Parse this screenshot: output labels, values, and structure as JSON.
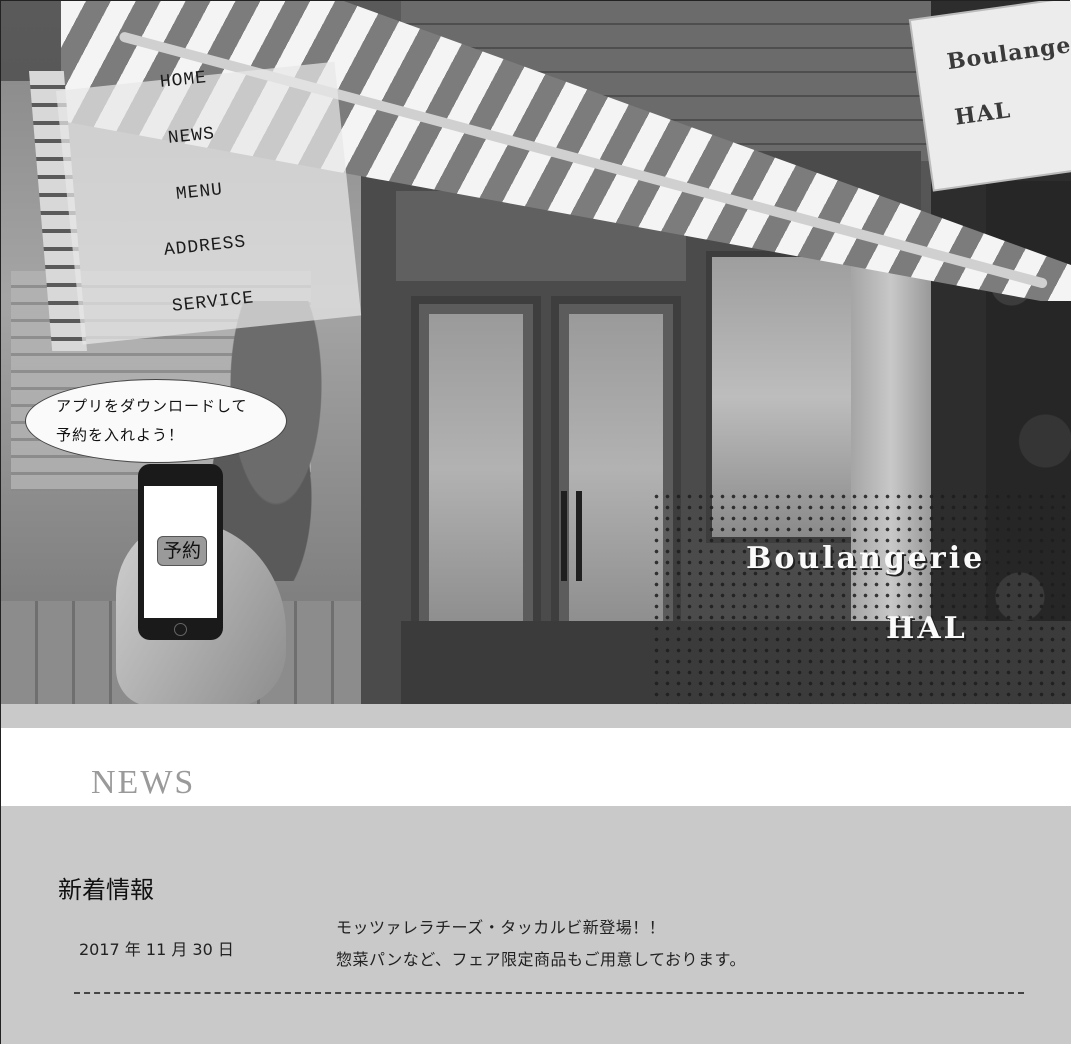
{
  "brand": {
    "sign_line1": "Boulange",
    "sign_line2": "HAL",
    "logo_line1": "Boulangerie",
    "logo_line2": "HAL"
  },
  "nav": {
    "items": [
      {
        "label": "HOME"
      },
      {
        "label": "NEWS"
      },
      {
        "label": "MENU"
      },
      {
        "label": "ADDRESS"
      },
      {
        "label": "SERVICE"
      }
    ]
  },
  "promo": {
    "line1": "アプリをダウンロードして",
    "line2": "予約を入れよう！",
    "reserve_label": "予約"
  },
  "news": {
    "heading": "NEWS",
    "section_title": "新着情報",
    "entries": [
      {
        "date": "2017 年 11 月 30 日",
        "line1": "モッツァレラチーズ・タッカルビ新登場！！",
        "line2": "惣菜パンなど、フェア限定商品もご用意しております。"
      }
    ]
  }
}
